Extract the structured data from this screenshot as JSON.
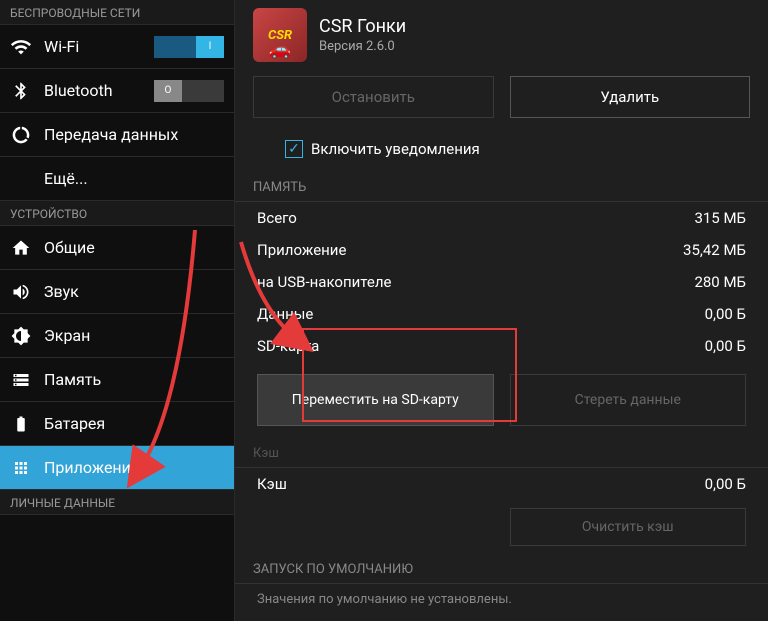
{
  "sidebar": {
    "sections": {
      "wireless": "БЕСПРОВОДНЫЕ СЕТИ",
      "device": "УСТРОЙСТВО",
      "personal": "ЛИЧНЫЕ ДАННЫЕ"
    },
    "items": {
      "wifi": "Wi-Fi",
      "bluetooth": "Bluetooth",
      "data": "Передача данных",
      "more": "Ещё...",
      "general": "Общие",
      "sound": "Звук",
      "display": "Экран",
      "storage": "Память",
      "battery": "Батарея",
      "apps": "Приложения"
    },
    "toggles": {
      "on": "I",
      "off": "O"
    }
  },
  "app": {
    "name": "CSR Гонки",
    "version": "Версия 2.6.0"
  },
  "buttons": {
    "stop": "Остановить",
    "delete": "Удалить",
    "move_sd": "Переместить на SD-карту",
    "clear_data": "Стереть данные",
    "clear_cache": "Очистить кэш"
  },
  "checkbox": {
    "notifications": "Включить уведомления"
  },
  "sections": {
    "storage": "ПАМЯТЬ",
    "cache_hidden": "Кэш",
    "launch": "ЗАПУСК ПО УМОЛЧАНИЮ"
  },
  "storage": {
    "total_label": "Всего",
    "total_val": "315 МБ",
    "app_label": "Приложение",
    "app_val": "35,42 МБ",
    "usb_label": "на USB-накопителе",
    "usb_val": "280 МБ",
    "data_label": "Данные",
    "data_val": "0,00 Б",
    "sd_label": "SD-карта",
    "sd_val": "0,00 Б"
  },
  "cache": {
    "label": "Кэш",
    "val": "0,00 Б"
  },
  "launch_text": "Значения по умолчанию не установлены."
}
